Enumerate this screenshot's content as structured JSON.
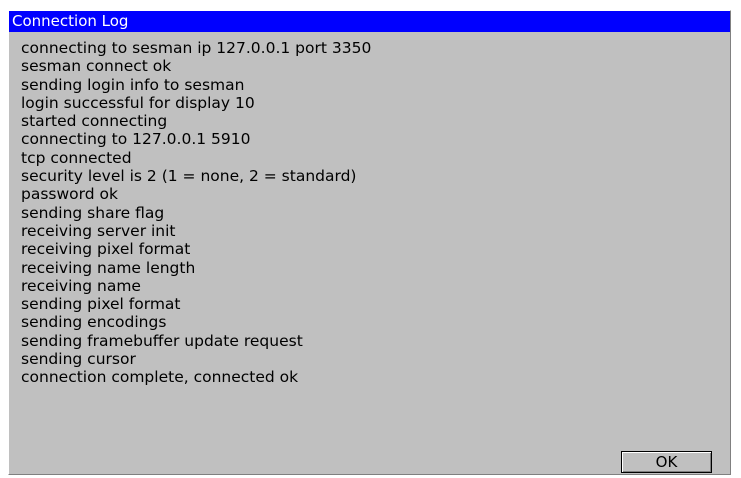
{
  "window": {
    "title": "Connection Log"
  },
  "log_lines": [
    "connecting to sesman ip 127.0.0.1 port 3350",
    "sesman connect ok",
    "sending login info to sesman",
    "login successful for display 10",
    "started connecting",
    "connecting to 127.0.0.1 5910",
    "tcp connected",
    "security level is 2 (1 = none, 2 = standard)",
    "password ok",
    "sending share flag",
    "receiving server init",
    "receiving pixel format",
    "receiving name length",
    "receiving name",
    "sending pixel format",
    "sending encodings",
    "sending framebuffer update request",
    "sending cursor",
    "connection complete, connected ok"
  ],
  "buttons": {
    "ok_label": "OK"
  },
  "colors": {
    "titlebar": "#0000ff",
    "titlebar_text": "#ffffff",
    "window_background": "#c0c0c0",
    "text": "#000000"
  }
}
